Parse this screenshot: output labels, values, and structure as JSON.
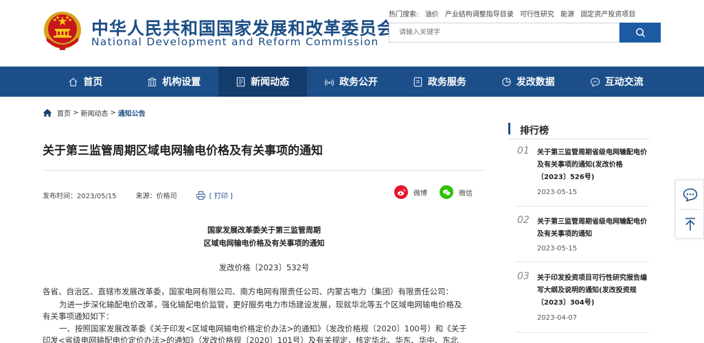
{
  "header": {
    "title_cn": "中华人民共和国国家发展和改革委员会",
    "title_en": "National Development and Reform Commission",
    "hot_label": "热门搜索:",
    "hot_links": [
      "油价",
      "产业结构调整指导目录",
      "可行性研究",
      "能源",
      "固定资产投资项目"
    ],
    "search_placeholder": "请输入关键字",
    "brand_color": "#1c4f8a"
  },
  "nav": {
    "items": [
      {
        "label": "首页",
        "icon": "home-icon"
      },
      {
        "label": "机构设置",
        "icon": "building-icon"
      },
      {
        "label": "新闻动态",
        "icon": "news-icon",
        "active": true
      },
      {
        "label": "政务公开",
        "icon": "broadcast-icon"
      },
      {
        "label": "政务服务",
        "icon": "service-icon"
      },
      {
        "label": "发改数据",
        "icon": "pie-chart-icon"
      },
      {
        "label": "互动交流",
        "icon": "chat-icon"
      }
    ]
  },
  "breadcrumb": {
    "items": [
      "首页",
      "新闻动态",
      "通知公告"
    ],
    "separator": ">"
  },
  "article": {
    "title": "关于第三监管周期区域电网输电价格及有关事项的通知",
    "publish_time": "发布时间：2023/05/15",
    "source": "来源：价格司",
    "print_label": "[ 打印 ]",
    "share_weibo": "微博",
    "share_wechat": "微信",
    "doc_head_line1": "国家发展改革委关于第三监管周期",
    "doc_head_line2": "区域电网输电价格及有关事项的通知",
    "doc_number": "发改价格〔2023〕532号",
    "para1": "各省、自治区、直辖市发展改革委，国家电网有限公司、南方电网有限责任公司、内蒙古电力（集团）有限责任公司：",
    "para2_line1": "为进一步深化输配电价改革，强化输配电价监管，更好服务电力市场建设发展，现就华北等五个区域电网输电价格及",
    "para2_line2": "有关事项通知如下：",
    "para3_line1": "一、按照国家发展改革委《关于印发<区域电网输电价格定价办法>的通知》（发改价格规〔2020〕100号）和《关于",
    "para3_line2": "印发<省级电网输配电价定价办法>的通知》（发改价格规〔2020〕101号）及有关规定，核定华北、华东、华中、东北"
  },
  "ranking": {
    "title": "排行榜",
    "items": [
      {
        "num": "01",
        "title": "关于第三监管周期省级电网输配电价及有关事项的通知(发改价格〔2023〕526号)",
        "date": "2023-05-15"
      },
      {
        "num": "02",
        "title": "关于第三监管周期省级电网输配电价及有关事项的通知",
        "date": "2023-05-15"
      },
      {
        "num": "03",
        "title": "关于印发投资项目可行性研究报告编写大纲及说明的通知(发改投资规〔2023〕304号)",
        "date": "2023-04-07"
      }
    ]
  }
}
